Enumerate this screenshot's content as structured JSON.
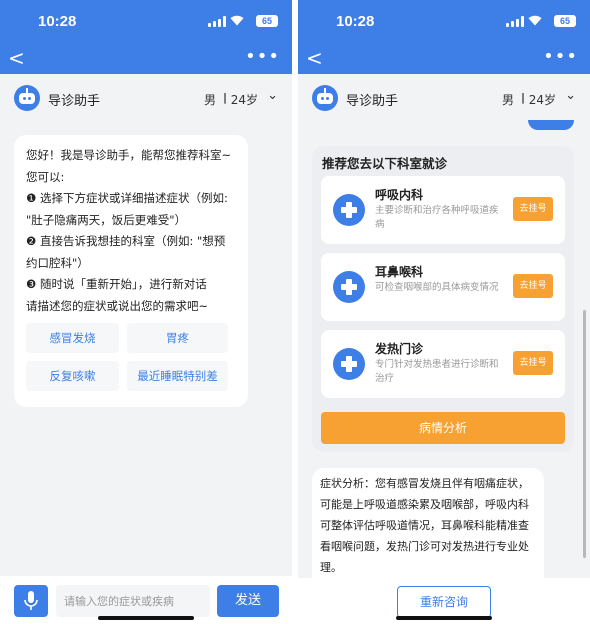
{
  "colors": {
    "primary": "#3d7fe6",
    "accent": "#f7a132",
    "background": "#f2f3f5"
  },
  "status_bar": {
    "time": "10:28",
    "battery": "65"
  },
  "nav": {
    "back_icon": "chevron-left-icon",
    "more_icon": "ellipsis-icon",
    "more_text": "•••",
    "back_text": "<"
  },
  "header": {
    "title": "导诊助手",
    "gender": "男",
    "separator": "|",
    "age": "24岁",
    "dropdown_icon": "chevron-down-icon",
    "chev_text": "⌄"
  },
  "greeting": {
    "text": "您好！我是导诊助手，能帮您推荐科室~\n您可以:\n❶ 选择下方症状或详细描述症状（例如: \"肚子隐痛两天，饭后更难受\"）\n❷ 直接告诉我想挂的科室（例如: \"想预约口腔科\"）\n❸ 随时说「重新开始」，进行新对话\n请描述您的症状或说出您的需求吧~",
    "chips": [
      "感冒发烧",
      "胃疼",
      "反复咳嗽",
      "最近睡眠特别差"
    ]
  },
  "input": {
    "placeholder": "请输入您的症状或疾病",
    "send_label": "发送"
  },
  "recommendation": {
    "title": "推荐您去以下科室就诊",
    "departments": [
      {
        "name": "呼吸内科",
        "desc": "主要诊断和治疗各种呼吸道疾病",
        "action": "去挂号"
      },
      {
        "name": "耳鼻喉科",
        "desc": "可检查咽喉部的具体病变情况",
        "action": "去挂号"
      },
      {
        "name": "发热门诊",
        "desc": "专门针对发热患者进行诊断和治疗",
        "action": "去挂号"
      }
    ],
    "analysis_button": "病情分析"
  },
  "analysis": {
    "text": "症状分析：您有感冒发烧且伴有咽痛症状，可能是上呼吸道感染累及咽喉部，呼吸内科可整体评估呼吸道情况，耳鼻喉科能精准查看咽喉问题，发热门诊可对发热进行专业处理。"
  },
  "restart_label": "重新咨询"
}
